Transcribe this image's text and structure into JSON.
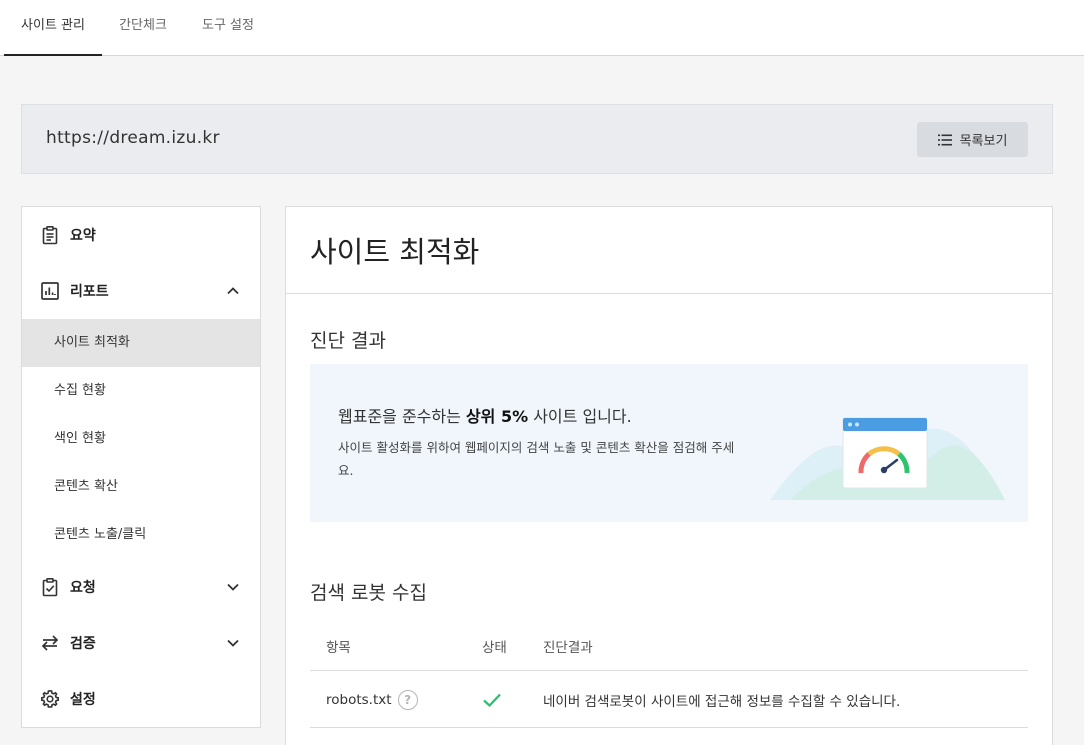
{
  "tabs": [
    {
      "label": "사이트 관리",
      "active": true
    },
    {
      "label": "간단체크",
      "active": false
    },
    {
      "label": "도구 설정",
      "active": false
    }
  ],
  "site": {
    "url": "https://dream.izu.kr",
    "list_button": "목록보기"
  },
  "sidebar": {
    "summary": "요약",
    "report": "리포트",
    "report_items": [
      "사이트 최적화",
      "수집 현황",
      "색인 현황",
      "콘텐츠 확산",
      "콘텐츠 노출/클릭"
    ],
    "request": "요청",
    "verify": "검증",
    "settings": "설정"
  },
  "main": {
    "title": "사이트 최적화",
    "diagnosis": {
      "section_title": "진단 결과",
      "headline_pre": "웹표준을 준수하는 ",
      "headline_bold": "상위 5%",
      "headline_post": " 사이트 입니다.",
      "description": "사이트 활성화를 위하여 웹페이지의 검색 노출 및 콘텐츠 확산을 점검해 주세요."
    },
    "robot": {
      "section_title": "검색 로봇 수집",
      "columns": [
        "항목",
        "상태",
        "진단결과"
      ],
      "rows": [
        {
          "item": "robots.txt",
          "help": "?",
          "status": "ok",
          "result": "네이버 검색로봇이 사이트에 접근해 정보를 수집할 수 있습니다."
        }
      ]
    }
  },
  "colors": {
    "accent_green": "#22c36b",
    "gauge_red": "#f06a6a",
    "gauge_yellow": "#f5c04a",
    "gauge_green": "#2ec46e",
    "window_blue": "#4a9de2"
  }
}
